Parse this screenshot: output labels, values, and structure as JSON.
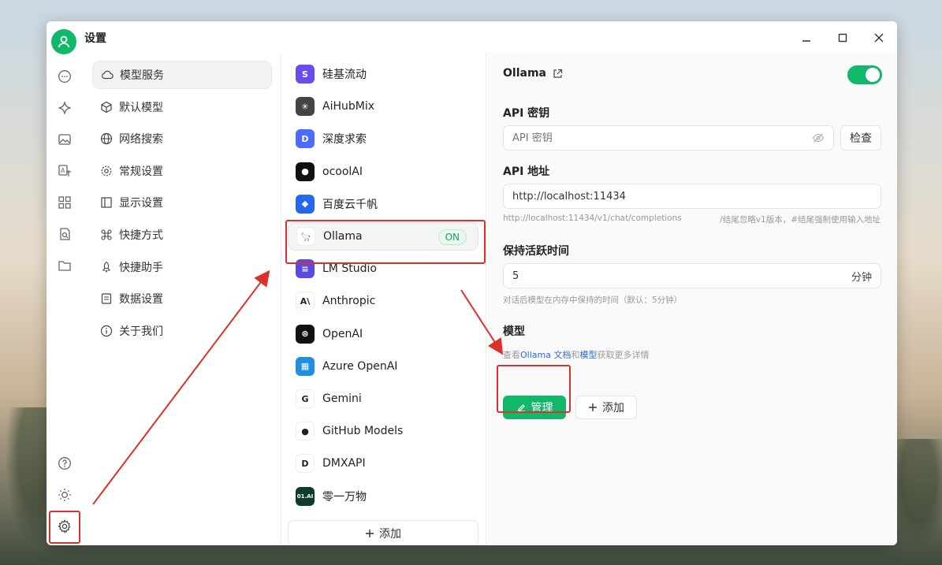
{
  "window": {
    "title": "设置"
  },
  "rail": {
    "top_icons": [
      "chat-icon",
      "sparkle-icon",
      "image-icon",
      "translate-icon",
      "apps-icon",
      "document-search-icon",
      "folder-icon"
    ],
    "bottom_icons": [
      "help-icon",
      "sun-icon",
      "gear-icon"
    ]
  },
  "nav": {
    "items": [
      {
        "label": "模型服务",
        "icon": "cloud-icon"
      },
      {
        "label": "默认模型",
        "icon": "cube-icon"
      },
      {
        "label": "网络搜索",
        "icon": "globe-icon"
      },
      {
        "label": "常规设置",
        "icon": "gear-icon"
      },
      {
        "label": "显示设置",
        "icon": "layout-icon"
      },
      {
        "label": "快捷方式",
        "icon": "command-icon"
      },
      {
        "label": "快捷助手",
        "icon": "rocket-icon"
      },
      {
        "label": "数据设置",
        "icon": "database-icon"
      },
      {
        "label": "关于我们",
        "icon": "info-icon"
      }
    ]
  },
  "providers": {
    "items": [
      {
        "label": "硅基流动",
        "color": "#6d4af0",
        "glyph": "S"
      },
      {
        "label": "AiHubMix",
        "color": "#444444",
        "glyph": "✳"
      },
      {
        "label": "深度求索",
        "color": "#4d6bfe",
        "glyph": "D"
      },
      {
        "label": "ocoolAI",
        "color": "#111111",
        "glyph": "●"
      },
      {
        "label": "百度云千帆",
        "color": "#2468f2",
        "glyph": "◆"
      },
      {
        "label": "Ollama",
        "color": "#ffffff",
        "glyph": "🦙"
      },
      {
        "label": "LM Studio",
        "color": "#5a4ae3",
        "glyph": "≡"
      },
      {
        "label": "Anthropic",
        "color": "#ffffff",
        "glyph": "A\\"
      },
      {
        "label": "OpenAI",
        "color": "#111111",
        "glyph": "⊛"
      },
      {
        "label": "Azure OpenAI",
        "color": "#1e8fe1",
        "glyph": "▦"
      },
      {
        "label": "Gemini",
        "color": "#ffffff",
        "glyph": "G"
      },
      {
        "label": "GitHub Models",
        "color": "#ffffff",
        "glyph": "●"
      },
      {
        "label": "DMXAPI",
        "color": "#ffffff",
        "glyph": "D"
      },
      {
        "label": "零一万物",
        "color": "#0d3b2e",
        "glyph": "01.AI"
      }
    ],
    "on_badge": "ON",
    "add_label": "添加"
  },
  "detail": {
    "provider_name": "Ollama",
    "enabled": true,
    "api_key_label": "API 密钥",
    "api_key_placeholder": "API 密钥",
    "check_label": "检查",
    "api_url_label": "API 地址",
    "api_url_value": "http://localhost:11434",
    "api_url_hint_left": "http://localhost:11434/v1/chat/completions",
    "api_url_hint_right": "/结尾忽略v1版本，#结尾强制使用输入地址",
    "keep_alive_label": "保持活跃时间",
    "keep_alive_value": "5",
    "keep_alive_unit": "分钟",
    "keep_alive_hint": "对话后模型在内存中保持的时间（默认：5分钟）",
    "models_label": "模型",
    "models_hint_pre": "查看",
    "models_hint_link1": "Ollama 文档",
    "models_hint_mid": "和",
    "models_hint_link2": "模型",
    "models_hint_post": "获取更多详情",
    "manage_label": "管理",
    "add_label": "添加"
  },
  "colors": {
    "accent": "#12b76a",
    "annotation": "#d9322b"
  }
}
